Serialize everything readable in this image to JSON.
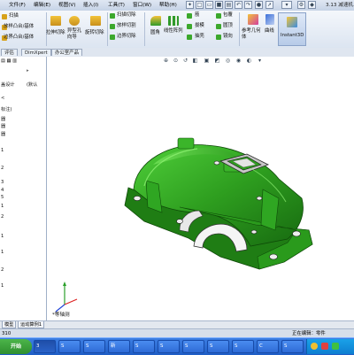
{
  "menubar": {
    "items": [
      "文件(F)",
      "编辑(E)",
      "视图(V)",
      "插入(I)",
      "工具(T)",
      "窗口(W)",
      "帮助(H)"
    ],
    "title": "3.13 减速机..."
  },
  "ribbon": {
    "col1": [
      "扫描",
      "放样凸台/基体",
      "边界凸台/基体"
    ],
    "extrude_cut": "拉伸切除",
    "hole_wizard": "异型孔向导",
    "revolve_cut": "旋转切除",
    "col_cut": [
      "扫描切除",
      "放样切割",
      "边界切除"
    ],
    "fillet": "圆角",
    "linear_pattern": "线性阵列",
    "col_feat": [
      "筋",
      "拔模",
      "抽壳"
    ],
    "col_feat2": [
      "包覆",
      "圆顶",
      "镜向"
    ],
    "ref_geometry": "参考几何体",
    "curves": "曲线",
    "instant3d": "Instant3D"
  },
  "tabs": [
    "评估",
    "DimXpert",
    "办公室产品"
  ],
  "left_panel": {
    "lines": [
      "工具",
      "盖设计",
      "(默认",
      "<",
      "标注)",
      "器",
      "器",
      "器",
      "1",
      "2",
      "3",
      "4",
      "5",
      "1",
      "2",
      "1",
      "1",
      "2",
      "1"
    ]
  },
  "viewport": {
    "view_label": "*等轴测"
  },
  "model_tabs": [
    "模型",
    "运动算例1"
  ],
  "statusbar": {
    "left": "310",
    "right": "正在编辑：零件"
  },
  "taskbar": {
    "start": "开始",
    "tasks": [
      "3",
      "S",
      "S",
      "新",
      "S",
      "S",
      "S",
      "S",
      "S",
      "C",
      "S"
    ]
  },
  "colors": {
    "model_green": "#2e9e1f",
    "ribbon_bg": "#e6edf6",
    "taskbar": "#2a66d2"
  }
}
